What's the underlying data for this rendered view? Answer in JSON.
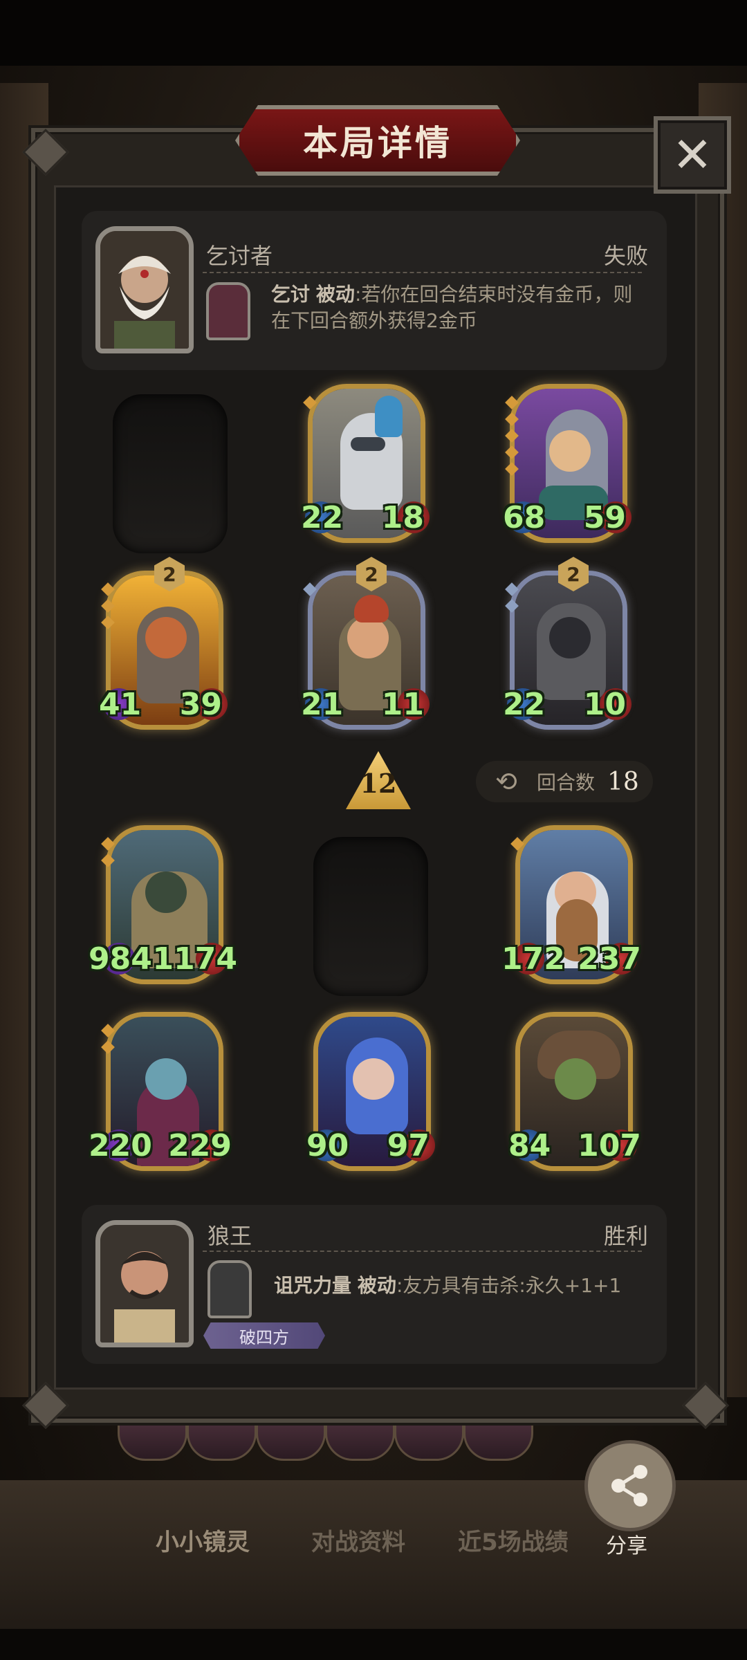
{
  "dialog": {
    "title": "本局详情"
  },
  "opponent": {
    "hero": "乞讨者",
    "result": "失败",
    "skill_name": "乞讨",
    "skill_type": "被动",
    "skill_text": ":若你在回合结束时没有金币，则在下回合额外获得2金币"
  },
  "opponent_board": [
    {
      "atk": "22",
      "hp": "18"
    },
    {
      "atk": "68",
      "hp": "59"
    },
    {
      "atk": "41",
      "hp": "39",
      "badge": "2"
    },
    {
      "atk": "21",
      "hp": "11",
      "badge": "2"
    },
    {
      "atk": "22",
      "hp": "10",
      "badge": "2"
    }
  ],
  "middle": {
    "tier": "12",
    "turns_label": "回合数",
    "turns_value": "18"
  },
  "player_board": [
    {
      "atk": "984",
      "hp": "1174"
    },
    {
      "atk": "172",
      "hp": "237"
    },
    {
      "atk": "220",
      "hp": "229"
    },
    {
      "atk": "90",
      "hp": "97"
    },
    {
      "atk": "84",
      "hp": "107"
    }
  ],
  "player": {
    "hero": "狼王",
    "result": "胜利",
    "skill_name": "诅咒力量",
    "skill_type": "被动",
    "skill_text": ":友方具有击杀:永久+1+1",
    "tag": "破四方"
  },
  "share": {
    "label": "分享"
  },
  "bottom_tabs": [
    "小小镜灵",
    "对战资料",
    "近5场战绩"
  ]
}
